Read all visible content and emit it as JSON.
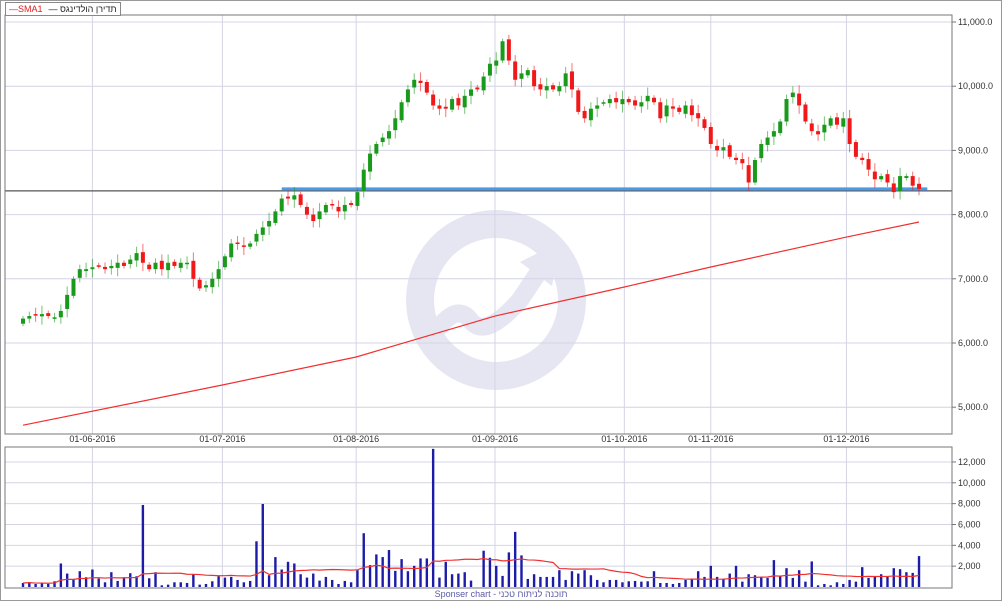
{
  "legend": {
    "sma_label": "—SMA1",
    "series_label": "— תדירן הולדינגס"
  },
  "sponsor_text": "Sponser chart - תוכנה לניתוח טכני",
  "colors": {
    "up": "#1a9a1a",
    "down": "#f01818",
    "sma": "#f03030",
    "volume": "#1c1ca8",
    "grid": "#d4d4e4",
    "support_line": "#4a9ae8",
    "ref_line": "#555555",
    "watermark": "#e6e6f2"
  },
  "chart_data": [
    {
      "type": "candlestick",
      "title": "תדירן הולדינגס",
      "ylim": [
        5000,
        11000
      ],
      "y_ticks": [
        5000,
        6000,
        7000,
        8000,
        9000,
        10000,
        11000
      ],
      "y_tick_labels": [
        "5,000.0",
        "6,000.0",
        "7,000.0",
        "8,000.0",
        "9,000.0",
        "10,000.0",
        "11,000.0"
      ],
      "x_tick_labels": [
        "01-06-2016",
        "01-07-2016",
        "01-08-2016",
        "01-09-2016",
        "01-10-2016",
        "01-11-2016",
        "01-12-2016"
      ],
      "x_tick_candle_index": [
        11,
        31.6,
        52.8,
        74.8,
        95.3,
        109,
        130.5
      ],
      "close": [
        6380,
        6420,
        6430,
        6450,
        6420,
        6400,
        6500,
        6750,
        7000,
        7150,
        7150,
        7180,
        7200,
        7150,
        7200,
        7250,
        7200,
        7300,
        7400,
        7250,
        7150,
        7250,
        7150,
        7250,
        7200,
        7250,
        7250,
        7000,
        6850,
        6900,
        7000,
        7150,
        7350,
        7550,
        7550,
        7500,
        7550,
        7700,
        7800,
        7900,
        8050,
        8250,
        8250,
        8300,
        8150,
        8000,
        7900,
        8050,
        8150,
        8150,
        8050,
        8150,
        8150,
        8350,
        8700,
        8950,
        9100,
        9200,
        9300,
        9500,
        9750,
        9950,
        10100,
        10050,
        9900,
        9700,
        9650,
        9650,
        9800,
        9700,
        9850,
        9950,
        9950,
        10150,
        10350,
        10400,
        10700,
        10400,
        10100,
        10200,
        10250,
        10000,
        9950,
        10000,
        9950,
        10000,
        10200,
        9950,
        9600,
        9500,
        9650,
        9700,
        9750,
        9800,
        9750,
        9800,
        9750,
        9700,
        9750,
        9850,
        9750,
        9500,
        9700,
        9650,
        9600,
        9700,
        9550,
        9500,
        9350,
        9100,
        9000,
        9050,
        8900,
        8850,
        8800,
        8500,
        8850,
        9100,
        9200,
        9300,
        9450,
        9800,
        9900,
        9700,
        9450,
        9300,
        9250,
        9400,
        9500,
        9400,
        9500,
        9100,
        8900,
        8850,
        8700,
        8550,
        8600,
        8500,
        8350,
        8600,
        8600,
        8450,
        8400
      ],
      "first_open": 6330,
      "sma": {
        "name": "SMA1",
        "candle_index": [
          0,
          31.6,
          52.8,
          74.8,
          95.3,
          109,
          130.5,
          142
        ],
        "values": [
          4720,
          5346,
          5782,
          6420,
          6872,
          7184,
          7650,
          7885
        ]
      },
      "ref_line_value": 8370,
      "support_line": {
        "value": 8400,
        "from_candle_index": 41
      }
    },
    {
      "type": "bar",
      "title": "Volume",
      "ylim": [
        0,
        13500
      ],
      "y_ticks": [
        2000,
        4000,
        6000,
        8000,
        10000,
        12000
      ],
      "y_tick_labels": [
        "2,000",
        "4,000",
        "6,000",
        "8,000",
        "10,000",
        "12,000"
      ],
      "sma_period": 20,
      "values": [
        387,
        452,
        290,
        387,
        290,
        548,
        2258,
        1290,
        710,
        1516,
        935,
        1677,
        806,
        452,
        1419,
        581,
        935,
        1323,
        1032,
        7871,
        839,
        1419,
        161,
        226,
        452,
        452,
        387,
        1194,
        226,
        290,
        548,
        1032,
        903,
        968,
        677,
        452,
        581,
        4387,
        7968,
        1129,
        2871,
        1677,
        2419,
        2258,
        1226,
        903,
        1290,
        613,
        968,
        677,
        290,
        581,
        452,
        1613,
        5161,
        2097,
        3129,
        2871,
        3548,
        1548,
        2677,
        1516,
        2032,
        2742,
        2742,
        13258,
        903,
        2419,
        1226,
        1290,
        1419,
        613,
        0,
        3484,
        2806,
        2032,
        1065,
        3323,
        5290,
        3032,
        774,
        1226,
        968,
        968,
        968,
        1613,
        677,
        1516,
        1290,
        1613,
        1129,
        677,
        452,
        677,
        677,
        452,
        548,
        581,
        516,
        548,
        1516,
        387,
        387,
        290,
        387,
        677,
        774,
        1516,
        968,
        2032,
        968,
        774,
        1290,
        2032,
        516,
        1226,
        1129,
        968,
        871,
        2581,
        1065,
        1806,
        871,
        1613,
        516,
        2452,
        161,
        290,
        161,
        452,
        290,
        677,
        516,
        1903,
        871,
        968,
        1226,
        968,
        1806,
        1710,
        1419,
        1355,
        2968
      ]
    }
  ]
}
